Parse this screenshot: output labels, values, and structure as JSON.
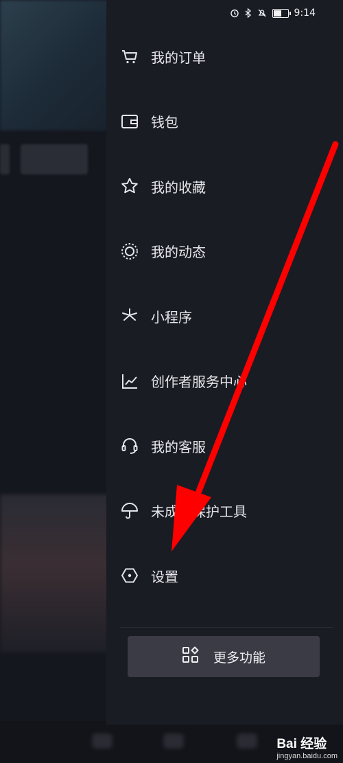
{
  "status_bar": {
    "time": "9:14"
  },
  "menu": {
    "items": [
      {
        "label": "我的订单",
        "icon": "cart-icon"
      },
      {
        "label": "钱包",
        "icon": "wallet-icon"
      },
      {
        "label": "我的收藏",
        "icon": "star-icon"
      },
      {
        "label": "我的动态",
        "icon": "moments-icon"
      },
      {
        "label": "小程序",
        "icon": "mini-program-icon"
      },
      {
        "label": "创作者服务中心",
        "icon": "chart-icon"
      },
      {
        "label": "我的客服",
        "icon": "headset-icon"
      },
      {
        "label": "未成年保护工具",
        "icon": "umbrella-icon"
      },
      {
        "label": "设置",
        "icon": "hexagon-settings-icon"
      }
    ]
  },
  "more_button": {
    "label": "更多功能",
    "icon": "grid-icon"
  },
  "watermark": {
    "text": "Bai 经验",
    "sub": "jingyan.baidu.com"
  },
  "colors": {
    "arrow": "#ff0000",
    "drawer_bg": "#1a1c24",
    "button_bg": "#3a3b44"
  }
}
